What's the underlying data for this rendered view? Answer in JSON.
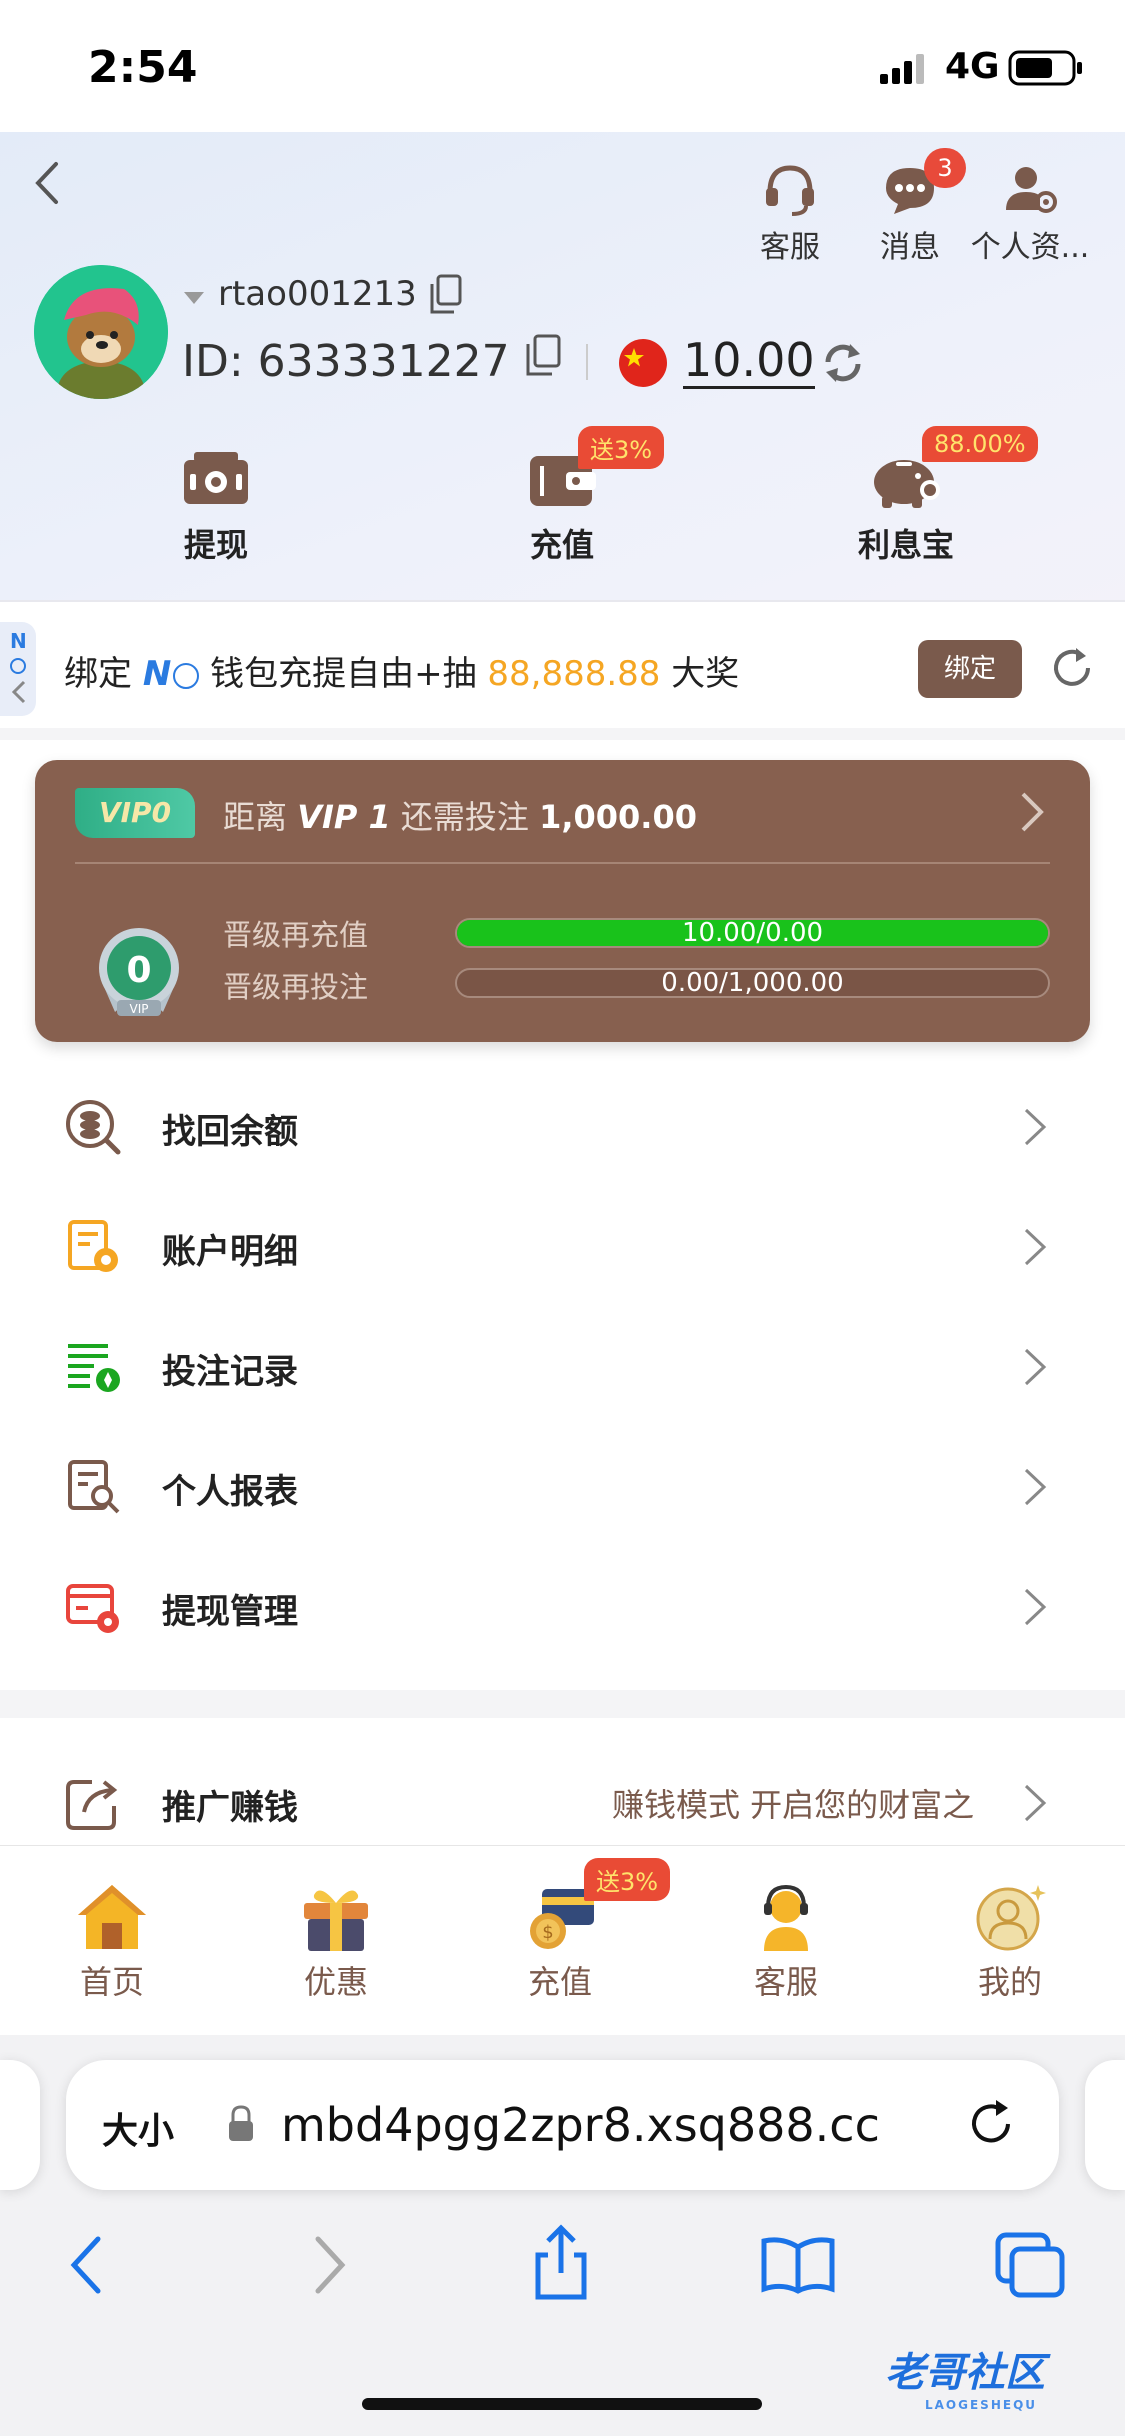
{
  "status_bar": {
    "time": "2:54",
    "network": "4G"
  },
  "header": {
    "top_icons": [
      {
        "label": "客服",
        "icon": "headset-icon"
      },
      {
        "label": "消息",
        "icon": "chat-icon",
        "badge": "3"
      },
      {
        "label": "个人资...",
        "icon": "user-settings-icon"
      }
    ],
    "username": "rtao001213",
    "id_text": "ID: 633331227",
    "balance": "10.00",
    "actions": [
      {
        "label": "提现",
        "icon": "withdraw-icon"
      },
      {
        "label": "充值",
        "icon": "wallet-icon",
        "tag": "送3%"
      },
      {
        "label": "利息宝",
        "icon": "piggy-bank-icon",
        "tag": "88.00%"
      }
    ]
  },
  "bind_banner": {
    "prefix": "绑定 ",
    "brand": "N",
    "middle": " 钱包充提自由+抽 ",
    "amount": "88,888.88",
    "suffix": " 大奖",
    "button": "绑定"
  },
  "vip": {
    "tag": "VIP0",
    "prefix": "距离 ",
    "level": "VIP 1",
    "middle": " 还需投注 ",
    "amount": "1,000.00",
    "badge_number": "0",
    "badge_text": "VIP",
    "rows": [
      {
        "label": "晋级再充值",
        "value": "10.00/0.00",
        "progress": 1.0
      },
      {
        "label": "晋级再投注",
        "value": "0.00/1,000.00",
        "progress": 0.0
      }
    ]
  },
  "menu": [
    {
      "label": "找回余额",
      "icon": "recover-balance-icon"
    },
    {
      "label": "账户明细",
      "icon": "account-detail-icon"
    },
    {
      "label": "投注记录",
      "icon": "bet-record-icon"
    },
    {
      "label": "个人报表",
      "icon": "report-icon"
    },
    {
      "label": "提现管理",
      "icon": "withdraw-manage-icon"
    }
  ],
  "promo": {
    "label": "推广赚钱",
    "text": "赚钱模式 开启您的财富之"
  },
  "tabbar": [
    {
      "label": "首页",
      "icon": "home-icon"
    },
    {
      "label": "优惠",
      "icon": "gift-icon"
    },
    {
      "label": "充值",
      "icon": "deposit-icon",
      "tag": "送3%"
    },
    {
      "label": "客服",
      "icon": "service-icon"
    },
    {
      "label": "我的",
      "icon": "profile-icon"
    }
  ],
  "browser": {
    "text_size": "大小",
    "url": "mbd4pgg2zpr8.xsq888.cc"
  },
  "watermark": {
    "text": "老哥社区",
    "sub": "LAOGESHEQU"
  },
  "colors": {
    "accent_brown": "#7a5a4c",
    "vip_card": "#87604f",
    "progress_green": "#19c21b",
    "badge_red": "#e84a3a",
    "gold": "#f5a623"
  }
}
